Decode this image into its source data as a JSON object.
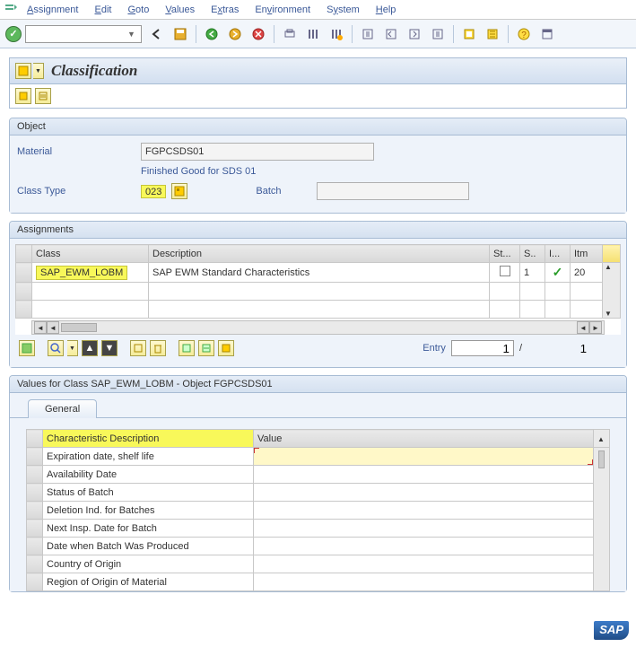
{
  "menus": [
    "Assignment",
    "Edit",
    "Goto",
    "Values",
    "Extras",
    "Environment",
    "System",
    "Help"
  ],
  "title": "Classification",
  "object": {
    "header": "Object",
    "material_label": "Material",
    "material_value": "FGPCSDS01",
    "material_desc": "Finished Good for SDS 01",
    "class_type_label": "Class Type",
    "class_type_value": "023",
    "batch_label": "Batch"
  },
  "assignments": {
    "header": "Assignments",
    "cols": {
      "class": "Class",
      "desc": "Description",
      "st": "St...",
      "s": "S..",
      "i": "I...",
      "itm": "Itm"
    },
    "row": {
      "class": "SAP_EWM_LOBM",
      "desc": "SAP EWM Standard Characteristics",
      "s": "1",
      "itm": "20"
    },
    "entry_label": "Entry",
    "entry_from": "1",
    "entry_to": "1"
  },
  "values": {
    "header": "Values for Class SAP_EWM_LOBM - Object FGPCSDS01",
    "tab": "General",
    "cols": {
      "desc": "Characteristic Description",
      "val": "Value"
    },
    "rows": [
      "Expiration date, shelf life",
      "Availability Date",
      "Status of Batch",
      "Deletion Ind. for Batches",
      "Next Insp. Date for Batch",
      "Date when Batch Was Produced",
      "Country of Origin",
      "Region of Origin of Material"
    ]
  },
  "logo": "SAP"
}
